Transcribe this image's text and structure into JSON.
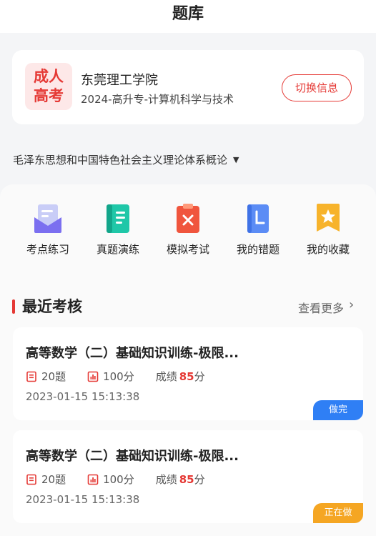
{
  "header": {
    "title": "题库"
  },
  "school": {
    "logo_line1": "成人",
    "logo_line2": "高考",
    "name": "东莞理工学院",
    "major": "2024-高升专-计算机科学与技术",
    "switch_label": "切换信息"
  },
  "subject": {
    "selected": "毛泽东思想和中国特色社会主义理论体系概论"
  },
  "tools": [
    {
      "label": "考点练习",
      "icon": "envelope-icon"
    },
    {
      "label": "真题演练",
      "icon": "notebook-icon"
    },
    {
      "label": "模拟考试",
      "icon": "exam-paper-icon"
    },
    {
      "label": "我的错题",
      "icon": "error-book-icon"
    },
    {
      "label": "我的收藏",
      "icon": "star-bookmark-icon"
    }
  ],
  "recent": {
    "title": "最近考核",
    "more_label": "查看更多",
    "items": [
      {
        "title": "高等数学（二）基础知识训练-极限...",
        "questions": "20题",
        "total": "100分",
        "score_label": "成绩",
        "score": "85",
        "score_unit": "分",
        "time": "2023-01-15 15:13:38",
        "status": "做完",
        "status_color": "#2f7ff5"
      },
      {
        "title": "高等数学（二）基础知识训练-极限...",
        "questions": "20题",
        "total": "100分",
        "score_label": "成绩",
        "score": "85",
        "score_unit": "分",
        "time": "2023-01-15 15:13:38",
        "status": "正在做",
        "status_color": "#f5a623"
      }
    ]
  },
  "colors": {
    "accent": "#e53935",
    "blue": "#2f7ff5",
    "orange": "#f5a623"
  }
}
